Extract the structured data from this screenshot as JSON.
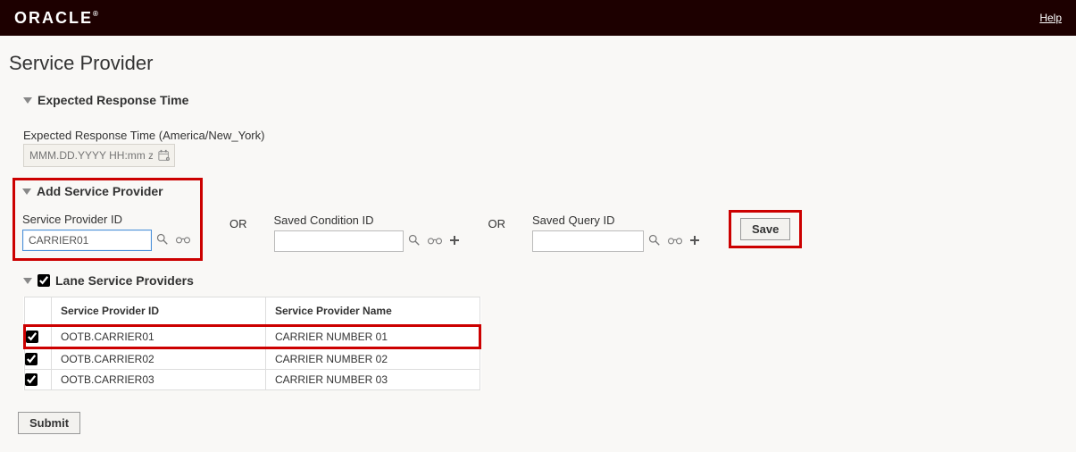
{
  "header": {
    "brand": "ORACLE",
    "help": "Help"
  },
  "page": {
    "title": "Service Provider"
  },
  "expected_response": {
    "header": "Expected Response Time",
    "label": "Expected Response Time (America/New_York)",
    "placeholder": "MMM.DD.YYYY HH:mm z"
  },
  "add_sp": {
    "header": "Add Service Provider",
    "sp_id_label": "Service Provider ID",
    "sp_id_value": "CARRIER01",
    "or": "OR",
    "saved_condition_label": "Saved Condition ID",
    "saved_condition_value": "",
    "saved_query_label": "Saved Query ID",
    "saved_query_value": "",
    "save_label": "Save"
  },
  "lane_sp": {
    "header": "Lane Service Providers",
    "col_id": "Service Provider ID",
    "col_name": "Service Provider Name",
    "rows": [
      {
        "checked": true,
        "id": "OOTB.CARRIER01",
        "name": "CARRIER NUMBER 01"
      },
      {
        "checked": true,
        "id": "OOTB.CARRIER02",
        "name": "CARRIER NUMBER 02"
      },
      {
        "checked": true,
        "id": "OOTB.CARRIER03",
        "name": "CARRIER NUMBER 03"
      }
    ]
  },
  "footer": {
    "submit": "Submit"
  },
  "highlight_color": "#c00"
}
